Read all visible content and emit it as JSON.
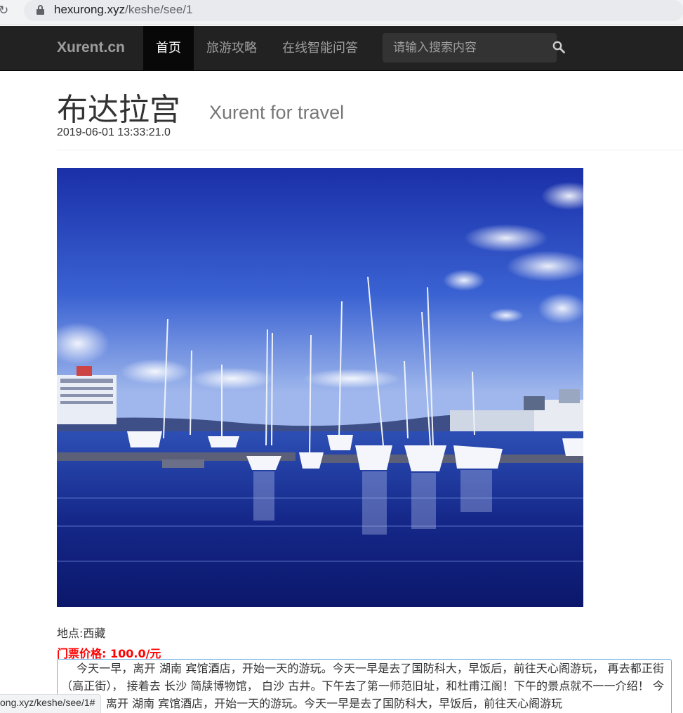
{
  "browser": {
    "url_host": "hexurong.xyz",
    "url_path": "/keshe/see/1",
    "status_url": "ong.xyz/keshe/see/1#"
  },
  "navbar": {
    "brand": "Xurent.cn",
    "items": [
      {
        "label": "首页",
        "active": true
      },
      {
        "label": "旅游攻略",
        "active": false
      },
      {
        "label": "在线智能问答",
        "active": false
      }
    ],
    "search_placeholder": "请输入搜索内容"
  },
  "article": {
    "title": "布达拉宫",
    "subtitle": "Xurent for travel",
    "date": "2019-06-01 13:33:21.0",
    "location": "地点:西藏",
    "price": "门票价格: 100.0/元",
    "description": "今天一早，离开 湖南 宾馆酒店，开始一天的游玩。今天一早是去了国防科大，早饭后，前往天心阁游玩， 再去都正街（高正街）， 接着去 长沙 简牍博物馆， 白沙 古井。下午去了第一师范旧址，和杜甫江阁！下午的景点就不一一介绍！ 今天一早，离开 湖南 宾馆酒店，开始一天的游玩。今天一早是去了国防科大，早饭后，前往天心阁游玩"
  },
  "colors": {
    "navbar_bg": "#222222",
    "price": "#ff0000",
    "sky": "#2b4fc4"
  }
}
